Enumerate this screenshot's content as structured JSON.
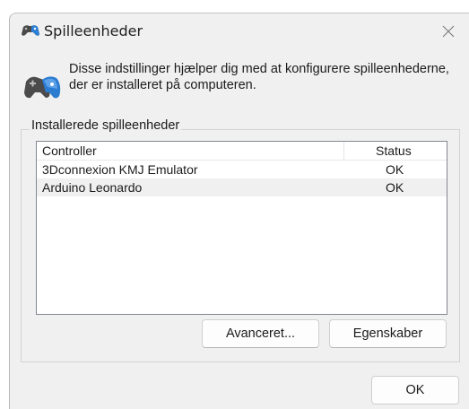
{
  "window": {
    "title": "Spilleenheder"
  },
  "header": {
    "text": "Disse indstillinger hjælper dig med at konfigurere spilleenhederne, der er installeret på computeren."
  },
  "group": {
    "label": "Installerede spilleenheder"
  },
  "list": {
    "columns": {
      "controller": "Controller",
      "status": "Status"
    },
    "rows": [
      {
        "name": "3Dconnexion KMJ Emulator",
        "status": "OK"
      },
      {
        "name": "Arduino Leonardo",
        "status": "OK"
      }
    ]
  },
  "buttons": {
    "advanced": "Avanceret...",
    "properties": "Egenskaber",
    "ok": "OK"
  },
  "icons": {
    "app": "gamepad-icon",
    "close": "close-icon"
  }
}
